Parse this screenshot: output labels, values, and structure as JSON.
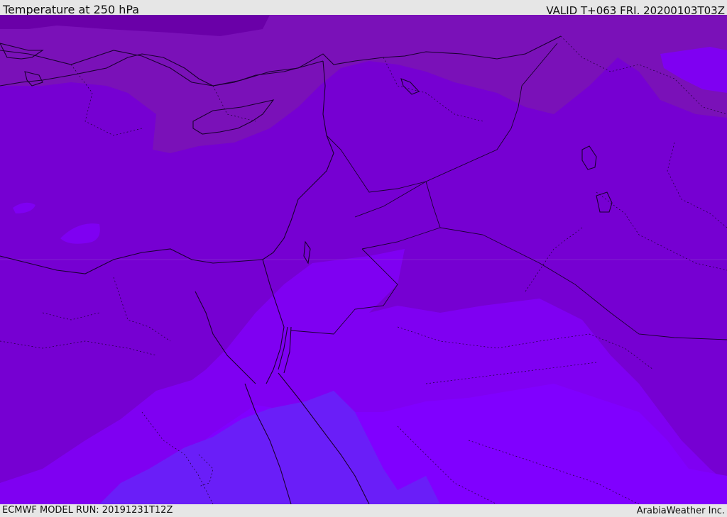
{
  "header": {
    "title": "Temperature at 250 hPa",
    "valid": "VALID T+063 FRI. 20200103T03Z"
  },
  "footer": {
    "model_run": "ECMWF MODEL RUN: 20191231T12Z",
    "credit": "ArabiaWeather Inc."
  },
  "map": {
    "variable": "temperature",
    "level": "250 hPa",
    "shading_colors": {
      "darkest": "#6a00a8",
      "dark": "#7a11b8",
      "base": "#7600d2",
      "mid": "#7f00f2",
      "light": "#8000ff",
      "bluish": "#6a1ef8"
    },
    "boundary_color": "#1a0030"
  }
}
